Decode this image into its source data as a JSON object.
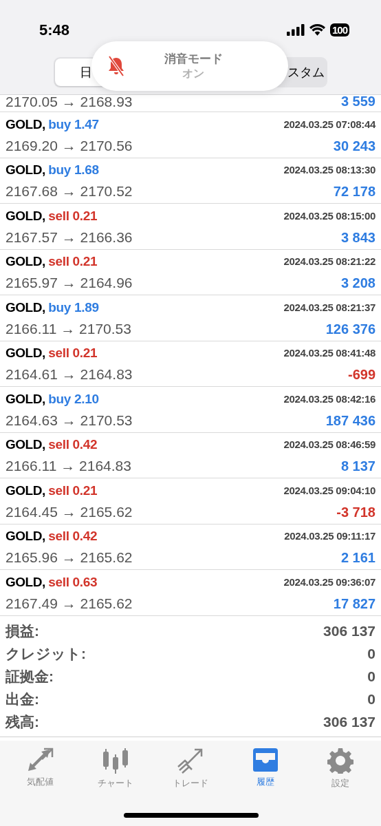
{
  "status_bar": {
    "time": "5:48",
    "battery": "100"
  },
  "segments": [
    {
      "label": "日",
      "selected": true
    },
    {
      "label": "スタム",
      "selected": false
    }
  ],
  "toast": {
    "title": "消音モード",
    "subtitle": "オン"
  },
  "partial_row": {
    "prices": "2170.05 → 2168.93",
    "profit": "3 559",
    "negative": false
  },
  "trades": [
    {
      "symbol": "GOLD,",
      "kind": "buy",
      "order": "buy 1.47",
      "time": "2024.03.25 07:08:44",
      "prices": "2169.20 → 2170.56",
      "profit": "30 243",
      "negative": false
    },
    {
      "symbol": "GOLD,",
      "kind": "buy",
      "order": "buy 1.68",
      "time": "2024.03.25 08:13:30",
      "prices": "2167.68 → 2170.52",
      "profit": "72 178",
      "negative": false
    },
    {
      "symbol": "GOLD,",
      "kind": "sell",
      "order": "sell 0.21",
      "time": "2024.03.25 08:15:00",
      "prices": "2167.57 → 2166.36",
      "profit": "3 843",
      "negative": false
    },
    {
      "symbol": "GOLD,",
      "kind": "sell",
      "order": "sell 0.21",
      "time": "2024.03.25 08:21:22",
      "prices": "2165.97 → 2164.96",
      "profit": "3 208",
      "negative": false
    },
    {
      "symbol": "GOLD,",
      "kind": "buy",
      "order": "buy 1.89",
      "time": "2024.03.25 08:21:37",
      "prices": "2166.11 → 2170.53",
      "profit": "126 376",
      "negative": false
    },
    {
      "symbol": "GOLD,",
      "kind": "sell",
      "order": "sell 0.21",
      "time": "2024.03.25 08:41:48",
      "prices": "2164.61 → 2164.83",
      "profit": "-699",
      "negative": true
    },
    {
      "symbol": "GOLD,",
      "kind": "buy",
      "order": "buy 2.10",
      "time": "2024.03.25 08:42:16",
      "prices": "2164.63 → 2170.53",
      "profit": "187 436",
      "negative": false
    },
    {
      "symbol": "GOLD,",
      "kind": "sell",
      "order": "sell 0.42",
      "time": "2024.03.25 08:46:59",
      "prices": "2166.11 → 2164.83",
      "profit": "8 137",
      "negative": false
    },
    {
      "symbol": "GOLD,",
      "kind": "sell",
      "order": "sell 0.21",
      "time": "2024.03.25 09:04:10",
      "prices": "2164.45 → 2165.62",
      "profit": "-3 718",
      "negative": true
    },
    {
      "symbol": "GOLD,",
      "kind": "sell",
      "order": "sell 0.42",
      "time": "2024.03.25 09:11:17",
      "prices": "2165.96 → 2165.62",
      "profit": "2 161",
      "negative": false
    },
    {
      "symbol": "GOLD,",
      "kind": "sell",
      "order": "sell 0.63",
      "time": "2024.03.25 09:36:07",
      "prices": "2167.49 → 2165.62",
      "profit": "17 827",
      "negative": false
    }
  ],
  "summary": [
    {
      "label": "損益:",
      "value": "306 137"
    },
    {
      "label": "クレジット:",
      "value": "0"
    },
    {
      "label": "証拠金:",
      "value": "0"
    },
    {
      "label": "出金:",
      "value": "0"
    },
    {
      "label": "残高:",
      "value": "306 137"
    }
  ],
  "tab_bar": [
    {
      "kind": "quotes",
      "label": "気配値",
      "selected": false
    },
    {
      "kind": "chart",
      "label": "チャート",
      "selected": false
    },
    {
      "kind": "trade",
      "label": "トレード",
      "selected": false
    },
    {
      "kind": "history",
      "label": "履歴",
      "selected": true
    },
    {
      "kind": "settings",
      "label": "設定",
      "selected": false
    }
  ]
}
